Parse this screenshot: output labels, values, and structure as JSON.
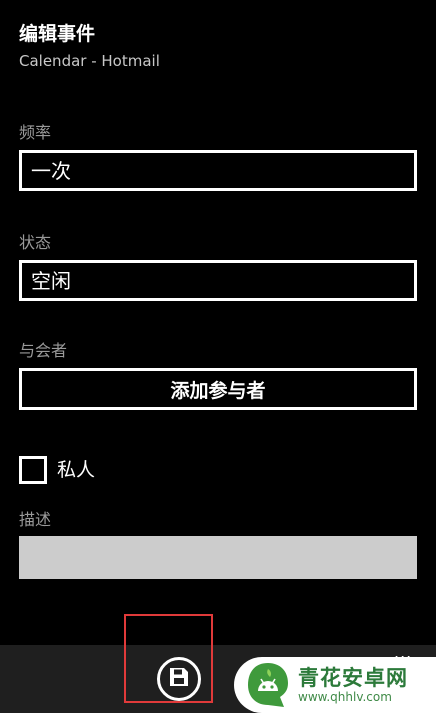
{
  "header": {
    "title": "编辑事件",
    "subtitle": "Calendar - Hotmail"
  },
  "fields": {
    "frequency": {
      "label": "频率",
      "value": "一次"
    },
    "status": {
      "label": "状态",
      "value": "空闲"
    },
    "attendees": {
      "label": "与会者",
      "button_label": "添加参与者"
    },
    "private": {
      "label": "私人",
      "checked": false
    },
    "description": {
      "label": "描述",
      "value": ""
    }
  },
  "app_bar": {
    "save_icon": "save-icon",
    "more_label": "...",
    "highlight_color": "#e03a3a"
  },
  "watermark": {
    "name": "青花安卓网",
    "url": "www.qhhlv.com"
  }
}
